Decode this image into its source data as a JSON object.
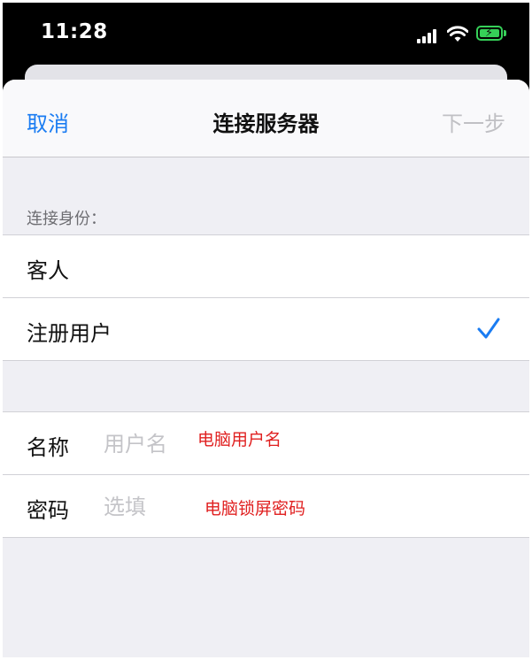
{
  "status_bar": {
    "time": "11:28"
  },
  "nav": {
    "cancel": "取消",
    "title": "连接服务器",
    "next": "下一步"
  },
  "connect_as": {
    "header": "连接身份：",
    "options": [
      {
        "label": "客人",
        "selected": false
      },
      {
        "label": "注册用户",
        "selected": true
      }
    ]
  },
  "form": {
    "name_label": "名称",
    "name_placeholder": "用户名",
    "password_label": "密码",
    "password_placeholder": "选填"
  },
  "annotations": {
    "name_hint": "电脑用户名",
    "password_hint": "电脑锁屏密码"
  },
  "colors": {
    "accent": "#1a7cf2",
    "annotation": "#e02020",
    "battery": "#36d058"
  }
}
